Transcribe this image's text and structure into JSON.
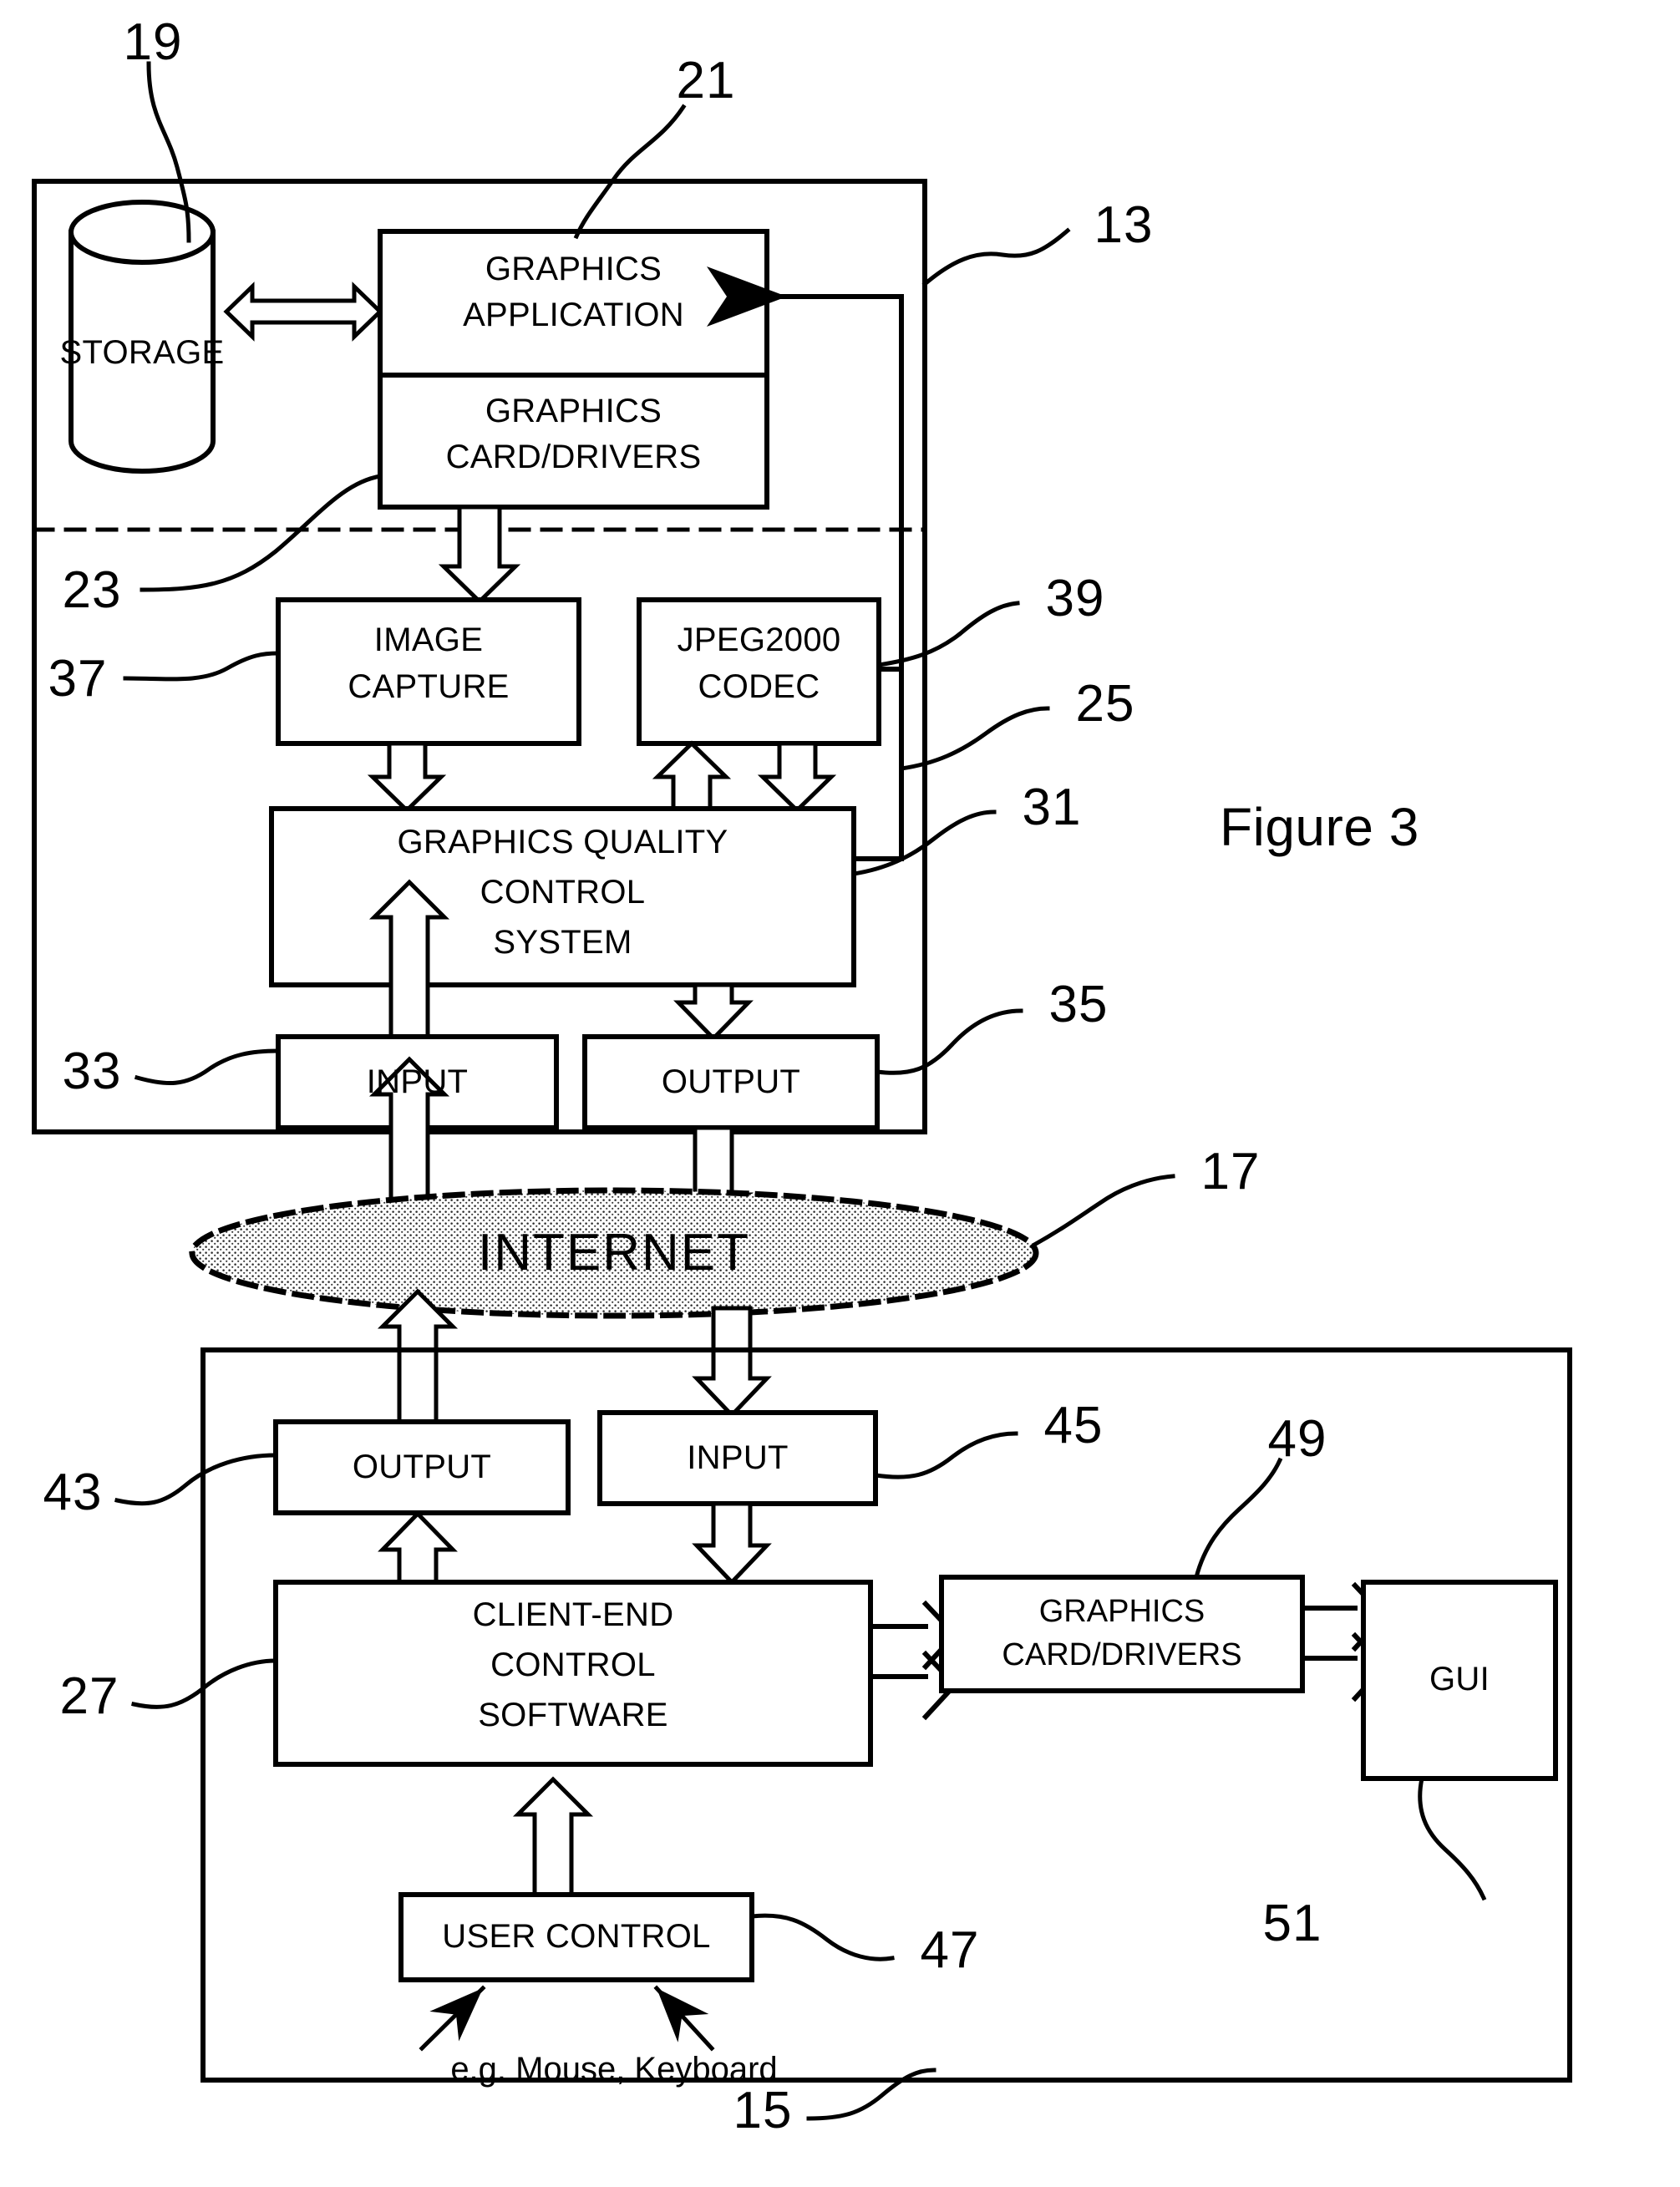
{
  "figure": {
    "label": "Figure 3"
  },
  "server_system": {
    "ref": "13",
    "storage": {
      "label": "STORAGE",
      "ref": "19"
    },
    "graphics_application": {
      "label_line1": "GRAPHICS",
      "label_line2": "APPLICATION",
      "ref": "21"
    },
    "graphics_card_drivers": {
      "label_line1": "GRAPHICS",
      "label_line2": "CARD/DRIVERS",
      "ref": "23"
    },
    "image_capture": {
      "label_line1": "IMAGE",
      "label_line2": "CAPTURE",
      "ref": "37"
    },
    "jpeg2000_codec": {
      "label_line1": "JPEG2000",
      "label_line2": "CODEC",
      "ref": "39"
    },
    "graphics_quality_control_system": {
      "label_line1": "GRAPHICS QUALITY",
      "label_line2": "CONTROL",
      "label_line3": "SYSTEM",
      "ref_left": "25",
      "ref_right": "31"
    },
    "input": {
      "label": "INPUT",
      "ref": "33"
    },
    "output": {
      "label": "OUTPUT",
      "ref": "35"
    }
  },
  "network": {
    "label": "INTERNET",
    "ref": "17"
  },
  "client_system": {
    "ref": "15",
    "output": {
      "label": "OUTPUT",
      "ref": "43"
    },
    "input": {
      "label": "INPUT",
      "ref": "45"
    },
    "client_end_control_software": {
      "label_line1": "CLIENT-END",
      "label_line2": "CONTROL",
      "label_line3": "SOFTWARE",
      "ref": "27"
    },
    "graphics_card_drivers": {
      "label_line1": "GRAPHICS",
      "label_line2": "CARD/DRIVERS",
      "ref": "49"
    },
    "gui": {
      "label": "GUI",
      "ref": "51"
    },
    "user_control": {
      "label": "USER CONTROL",
      "ref": "47"
    },
    "user_control_note": "e.g. Mouse, Keyboard"
  },
  "colors": {
    "line": "#000000",
    "fill": "#ffffff",
    "internet_fill": "#d8d8d8"
  }
}
